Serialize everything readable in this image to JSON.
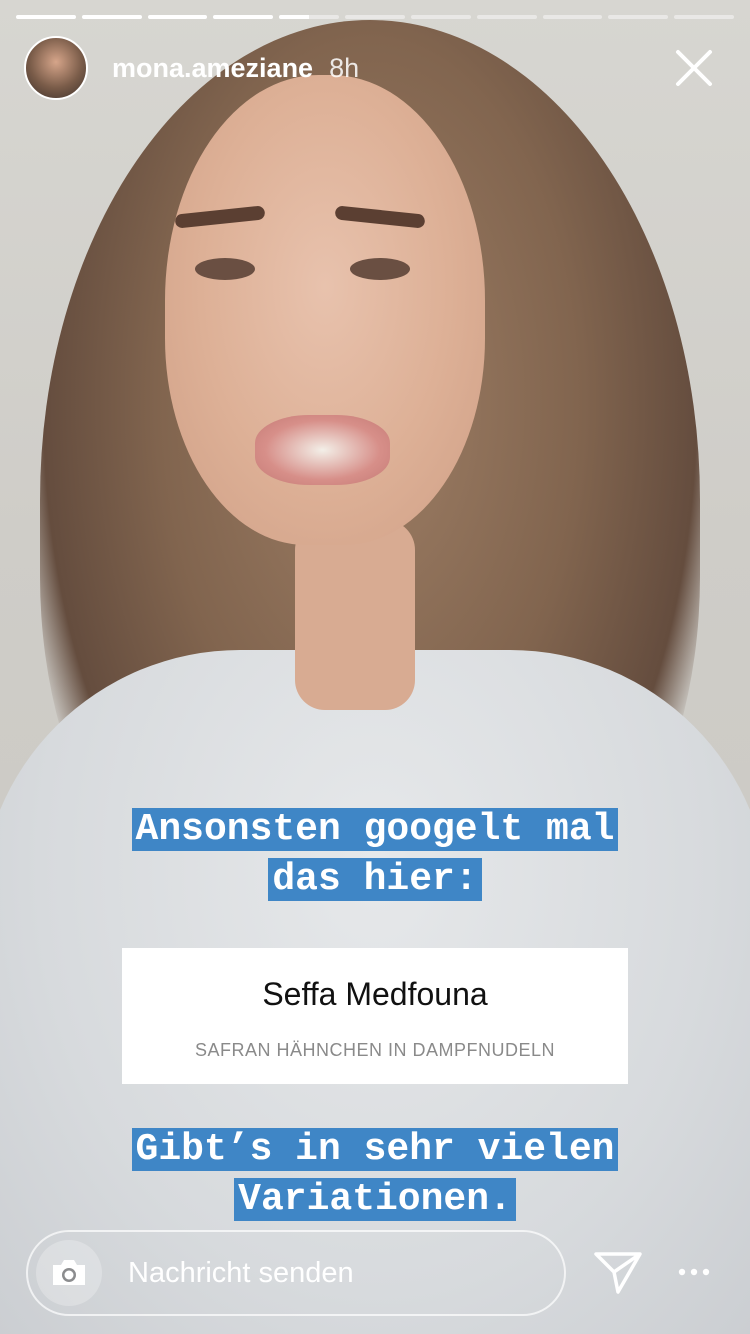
{
  "story": {
    "username": "mona.ameziane",
    "time_ago": "8h",
    "progress_segments": [
      1,
      1,
      1,
      1,
      0.5,
      0,
      0,
      0,
      0,
      0,
      0
    ],
    "captions": {
      "line1": "Ansonsten googelt mal",
      "line2": "das hier:",
      "line3": "Gibt’s in sehr vielen",
      "line4": "Variationen."
    },
    "card": {
      "title": "Seffa Medfouna",
      "subtitle": "SAFRAN HÄHNCHEN IN DAMPFNUDELN"
    },
    "reply": {
      "placeholder": "Nachricht senden"
    },
    "icons": {
      "close": "close-icon",
      "camera": "camera-icon",
      "send": "send-icon",
      "more": "more-icon"
    },
    "colors": {
      "caption_bg": "#3f86c6"
    }
  }
}
